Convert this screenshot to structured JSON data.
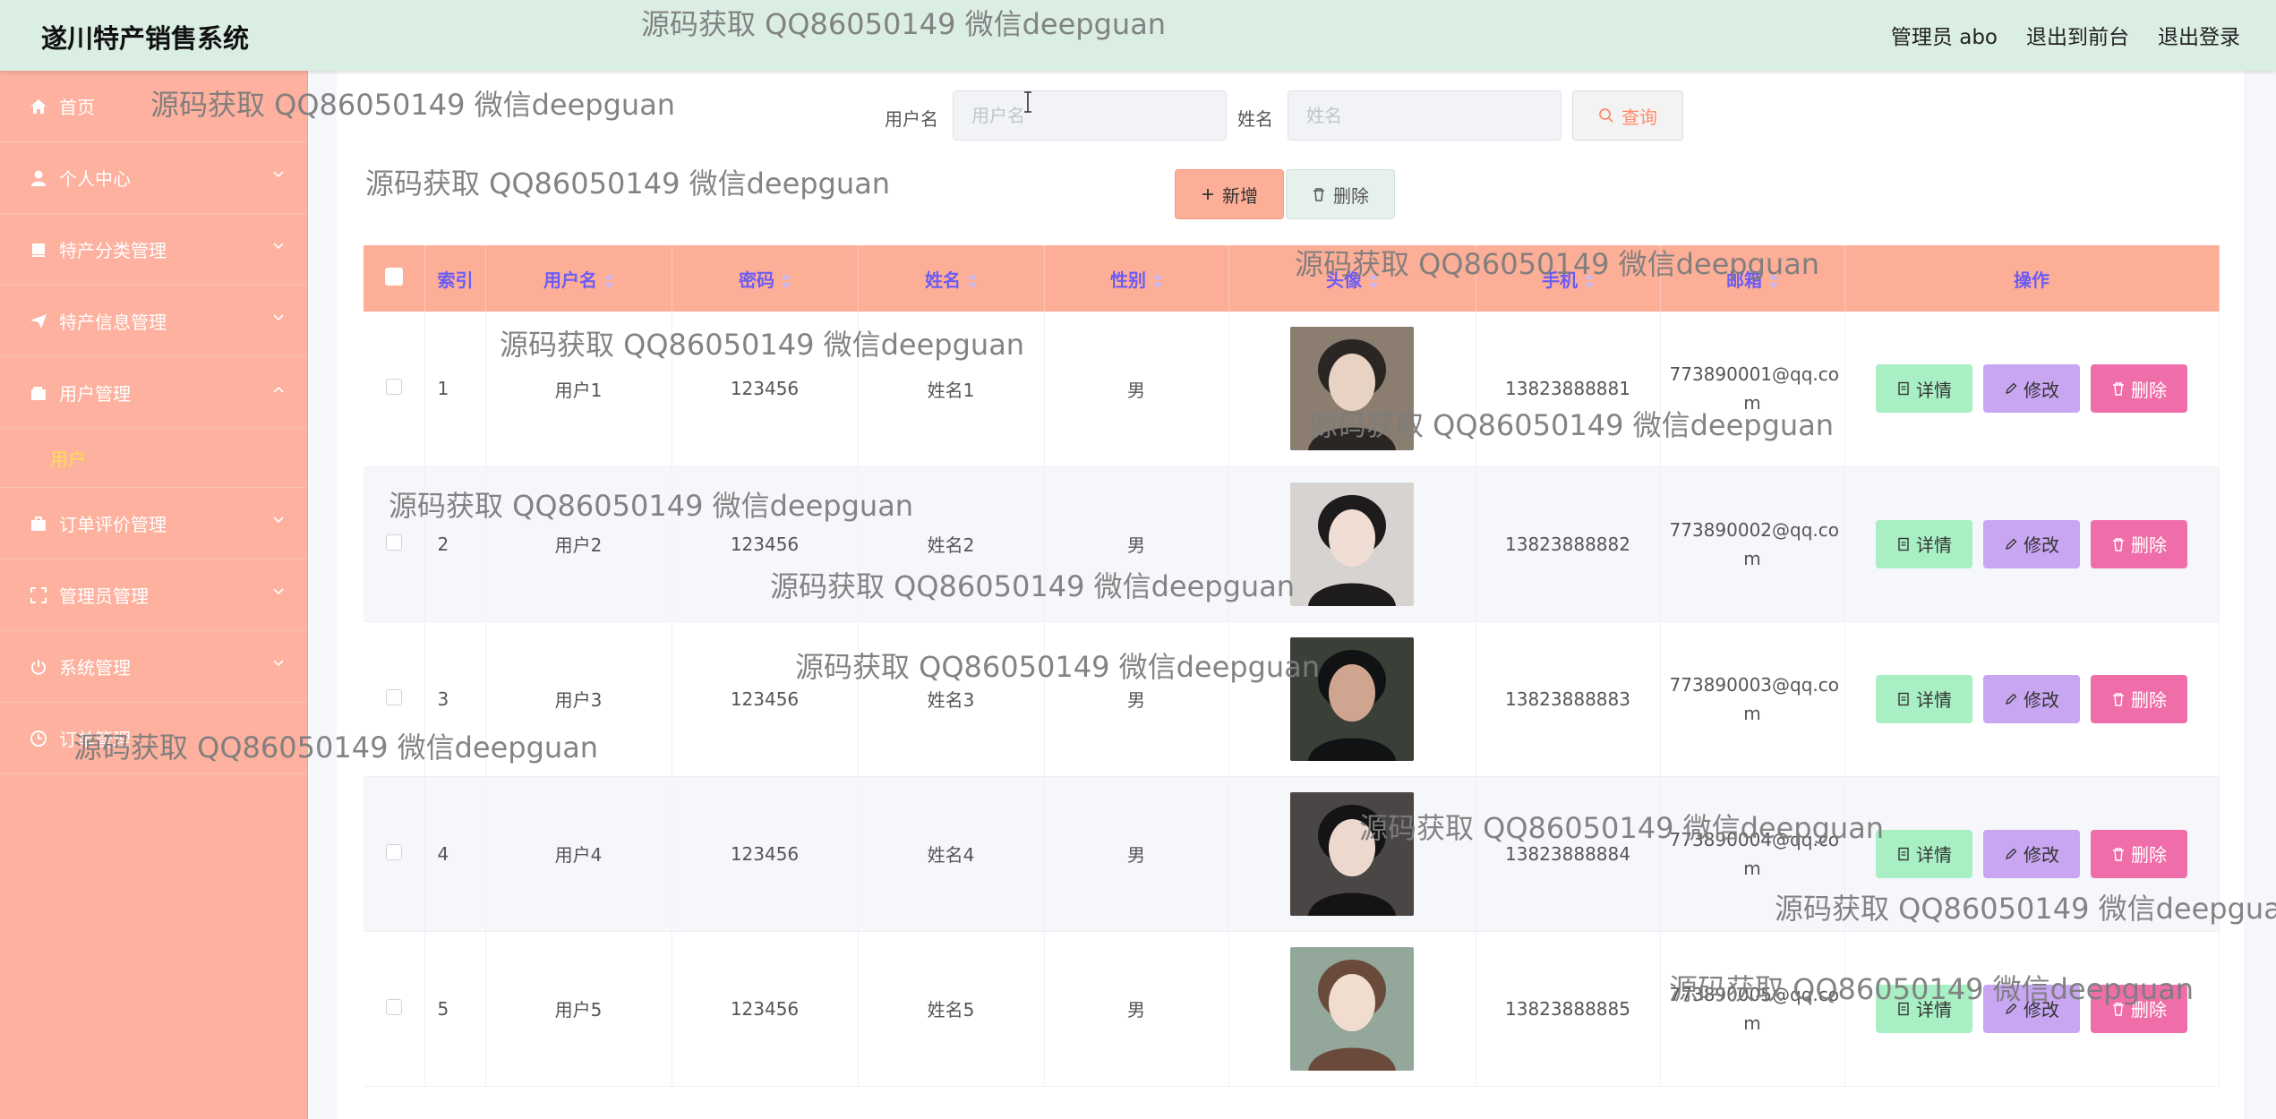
{
  "header": {
    "title": "遂川特产销售系统",
    "user_label": "管理员 abo",
    "to_front_label": "退出到前台",
    "logout_label": "退出登录"
  },
  "sidebar": {
    "items": [
      {
        "label": "首页",
        "icon": "home-icon"
      },
      {
        "label": "个人中心",
        "icon": "person-icon"
      },
      {
        "label": "特产分类管理",
        "icon": "book-icon"
      },
      {
        "label": "特产信息管理",
        "icon": "send-icon"
      },
      {
        "label": "用户管理",
        "icon": "wallet-icon"
      },
      {
        "label": "订单评价管理",
        "icon": "briefcase-icon"
      },
      {
        "label": "管理员管理",
        "icon": "frame-icon"
      },
      {
        "label": "系统管理",
        "icon": "power-icon"
      },
      {
        "label": "订单管理",
        "icon": "clock-icon"
      }
    ],
    "active_sub": "用户"
  },
  "search": {
    "username_label": "用户名",
    "username_placeholder": "用户名",
    "name_label": "姓名",
    "name_placeholder": "姓名",
    "query_label": "查询"
  },
  "toolbar": {
    "add_label": "新增",
    "delete_label": "删除"
  },
  "table": {
    "headers": [
      "索引",
      "用户名",
      "密码",
      "姓名",
      "性别",
      "头像",
      "手机",
      "邮箱",
      "操作"
    ],
    "rows": [
      {
        "index": "1",
        "username": "用户1",
        "password": "123456",
        "name": "姓名1",
        "gender": "男",
        "phone": "13823888881",
        "email_a": "773890001@qq.co",
        "email_b": "m"
      },
      {
        "index": "2",
        "username": "用户2",
        "password": "123456",
        "name": "姓名2",
        "gender": "男",
        "phone": "13823888882",
        "email_a": "773890002@qq.co",
        "email_b": "m"
      },
      {
        "index": "3",
        "username": "用户3",
        "password": "123456",
        "name": "姓名3",
        "gender": "男",
        "phone": "13823888883",
        "email_a": "773890003@qq.co",
        "email_b": "m"
      },
      {
        "index": "4",
        "username": "用户4",
        "password": "123456",
        "name": "姓名4",
        "gender": "男",
        "phone": "13823888884",
        "email_a": "773890004@qq.co",
        "email_b": "m"
      },
      {
        "index": "5",
        "username": "用户5",
        "password": "123456",
        "name": "姓名5",
        "gender": "男",
        "phone": "13823888885",
        "email_a": "773890005@qq.co",
        "email_b": "m"
      }
    ],
    "row_actions": {
      "detail": "详情",
      "edit": "修改",
      "delete": "删除"
    }
  },
  "watermark": "源码获取 QQ86050149 微信deepguan",
  "colors": {
    "header_bg": "#dbeee4",
    "sidebar_bg": "#fdb19e",
    "table_header_bg": "#fdae97",
    "active_sub": "#ffe14b",
    "detail_btn": "#a8f0c4",
    "edit_btn": "#c8a6f2",
    "delete_btn": "#ef6ea9"
  }
}
